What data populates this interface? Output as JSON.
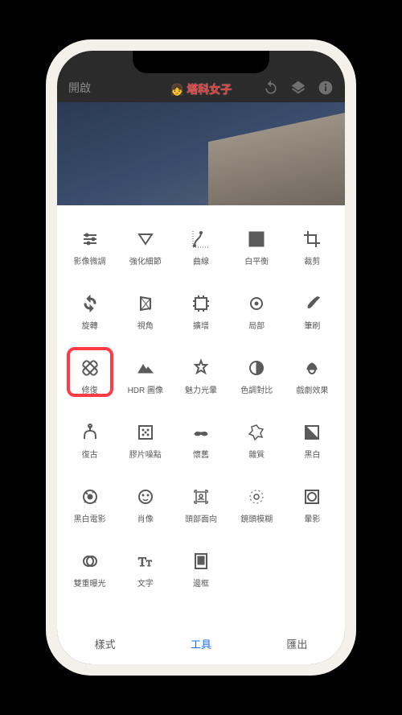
{
  "header": {
    "open_label": "開啟",
    "watermark": "塔科女子"
  },
  "tools": [
    {
      "label": "影像微調",
      "icon": "tune"
    },
    {
      "label": "強化細節",
      "icon": "triangle-down"
    },
    {
      "label": "曲線",
      "icon": "curves"
    },
    {
      "label": "白平衡",
      "icon": "wb"
    },
    {
      "label": "裁剪",
      "icon": "crop"
    },
    {
      "label": "旋轉",
      "icon": "rotate"
    },
    {
      "label": "視角",
      "icon": "perspective"
    },
    {
      "label": "擴增",
      "icon": "expand"
    },
    {
      "label": "局部",
      "icon": "target"
    },
    {
      "label": "筆刷",
      "icon": "brush"
    },
    {
      "label": "修復",
      "icon": "heal",
      "highlight": true
    },
    {
      "label": "HDR 圖像",
      "icon": "mountain"
    },
    {
      "label": "魅力光暈",
      "icon": "glamour"
    },
    {
      "label": "色調對比",
      "icon": "tonal"
    },
    {
      "label": "戲劇效果",
      "icon": "drama"
    },
    {
      "label": "復古",
      "icon": "vintage"
    },
    {
      "label": "膠片噪點",
      "icon": "grainy"
    },
    {
      "label": "懷舊",
      "icon": "mustache"
    },
    {
      "label": "雜質",
      "icon": "grunge"
    },
    {
      "label": "黑白",
      "icon": "bw"
    },
    {
      "label": "黑白電影",
      "icon": "noir"
    },
    {
      "label": "肖像",
      "icon": "face"
    },
    {
      "label": "頭部面向",
      "icon": "headpose"
    },
    {
      "label": "鏡頭模糊",
      "icon": "lensblur"
    },
    {
      "label": "暈影",
      "icon": "vignette"
    },
    {
      "label": "雙重曝光",
      "icon": "double"
    },
    {
      "label": "文字",
      "icon": "text"
    },
    {
      "label": "邊框",
      "icon": "frame"
    }
  ],
  "tabs": {
    "styles": "樣式",
    "tools": "工具",
    "export": "匯出"
  }
}
